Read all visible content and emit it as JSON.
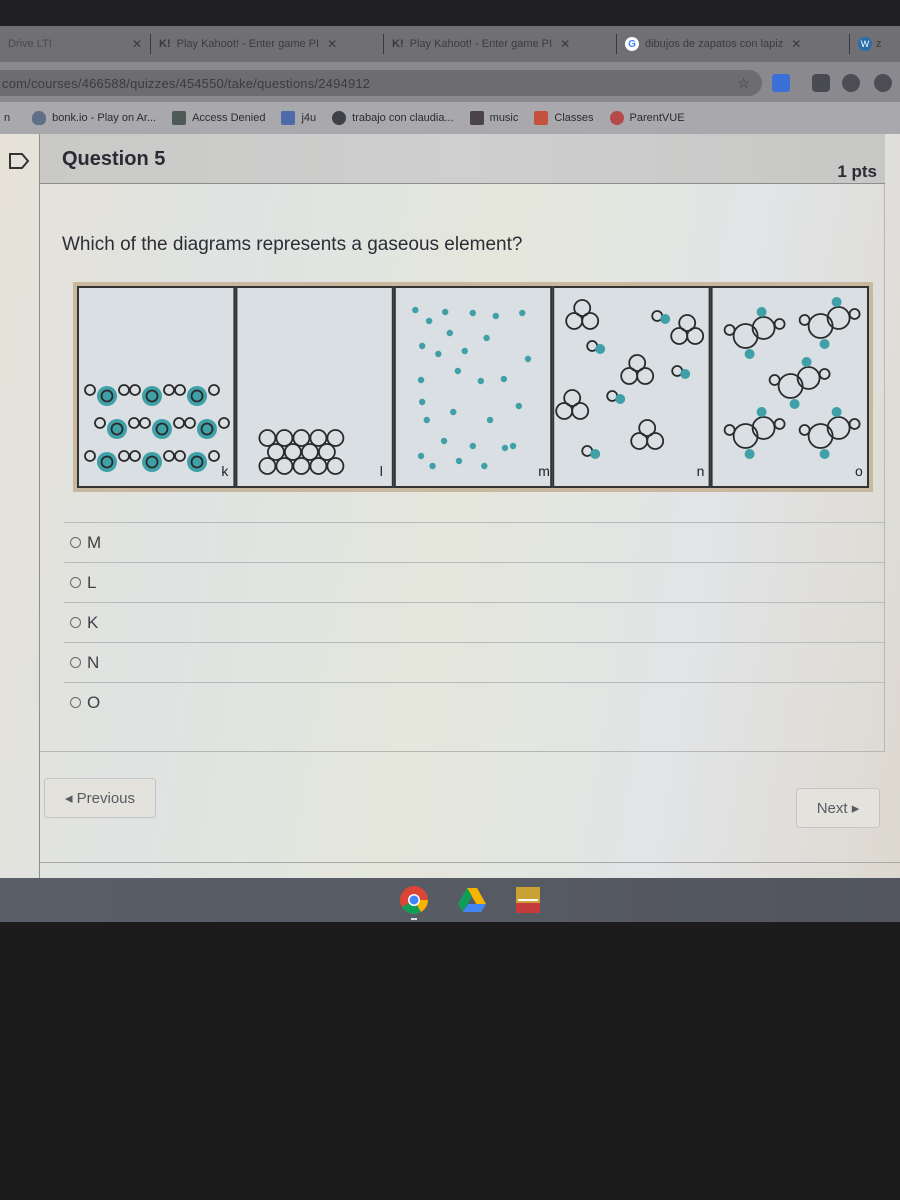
{
  "browser": {
    "tabs": [
      {
        "title": "Drive LTI",
        "icon": "drive-tab-icon",
        "active": false
      },
      {
        "title": "Play Kahoot! - Enter game PI",
        "icon": "kahoot-icon",
        "active": false
      },
      {
        "title": "Play Kahoot! - Enter game PI",
        "icon": "kahoot-icon",
        "active": false
      },
      {
        "title": "dibujos de zapatos con lapiz",
        "icon": "google-icon",
        "active": false
      },
      {
        "title": "z",
        "icon": "wordpress-icon",
        "active": false
      }
    ],
    "tab_close_glyph": "✕",
    "kahoot_glyph": "K!",
    "google_glyph": "G",
    "wordpress_glyph": "W",
    "url": "com/courses/466588/quizzes/454550/take/questions/2494912",
    "star_glyph": "☆",
    "bookmarks": [
      {
        "label": "n",
        "icon": "none"
      },
      {
        "label": "bonk.io - Play on Ar...",
        "icon": "shield-icon"
      },
      {
        "label": "Access Denied",
        "icon": "page-icon"
      },
      {
        "label": "j4u",
        "icon": "grid-icon"
      },
      {
        "label": "trabajo con claudia...",
        "icon": "globe-icon"
      },
      {
        "label": "music",
        "icon": "music-icon"
      },
      {
        "label": "Classes",
        "icon": "classroom-icon"
      },
      {
        "label": "ParentVUE",
        "icon": "parentvue-icon"
      }
    ]
  },
  "quiz": {
    "question_title": "Question 5",
    "points": "1 pts",
    "question_text": "Which of the diagrams represents a gaseous element?",
    "diagram_labels": [
      "k",
      "l",
      "m",
      "n",
      "o"
    ],
    "answers": [
      {
        "label": "M",
        "selected": false
      },
      {
        "label": "L",
        "selected": false
      },
      {
        "label": "K",
        "selected": false
      },
      {
        "label": "N",
        "selected": false
      },
      {
        "label": "O",
        "selected": false
      }
    ],
    "previous_label": "◂ Previous",
    "next_label": "Next ▸"
  },
  "shelf": {
    "apps": [
      "chrome-icon",
      "google-drive-icon",
      "education-app-icon"
    ]
  },
  "colors": {
    "particle_teal": "#3fa0a8",
    "particle_outline": "#2a2a2a"
  }
}
